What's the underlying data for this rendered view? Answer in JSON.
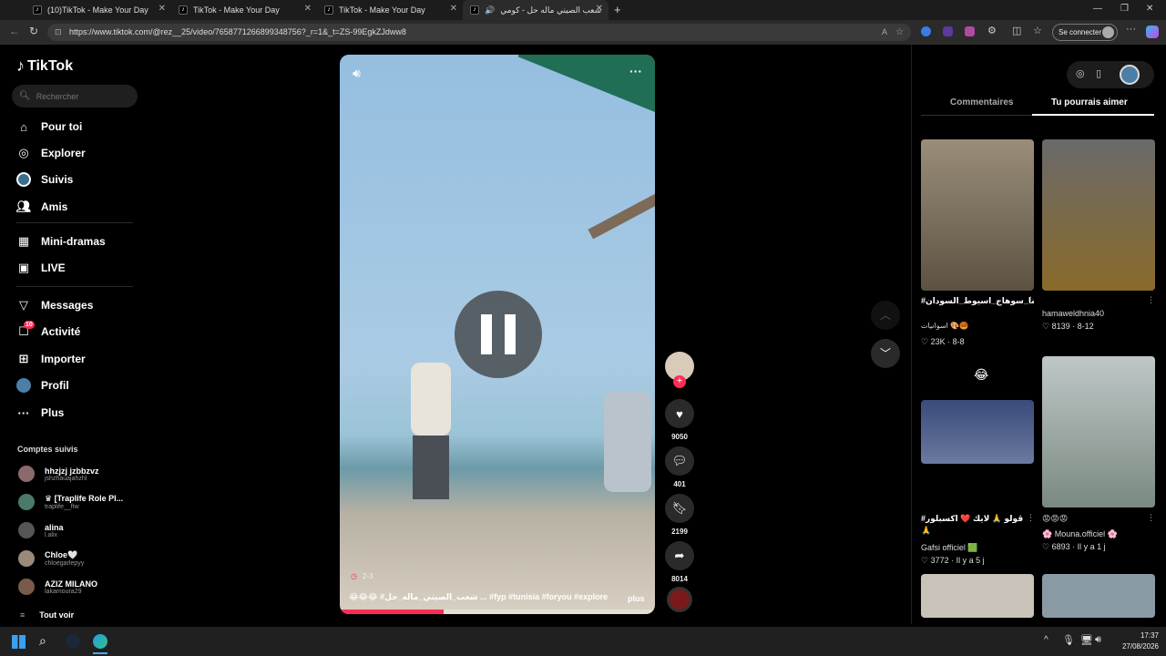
{
  "browser": {
    "tabs": [
      {
        "label": "(10)TikTok - Make Your Day"
      },
      {
        "label": "TikTok - Make Your Day"
      },
      {
        "label": "TikTok - Make Your Day"
      },
      {
        "label": "شعب الصيني ماله حل - كومي"
      }
    ],
    "url": "https://www.tiktok.com/@rez__25/video/7658771266899348756?_r=1&_t=ZS-99EgkZJdww8",
    "signin_label": "Se connecter"
  },
  "sidebar": {
    "logo": "TikTok",
    "search_placeholder": "Rechercher",
    "nav": [
      {
        "label": "Pour toi",
        "icon": "home-icon"
      },
      {
        "label": "Explorer",
        "icon": "compass-icon"
      },
      {
        "label": "Suivis",
        "icon": "following-icon"
      },
      {
        "label": "Amis",
        "icon": "friends-icon"
      },
      {
        "label": "Mini-dramas",
        "icon": "film-icon"
      },
      {
        "label": "LIVE",
        "icon": "live-icon"
      },
      {
        "label": "Messages",
        "icon": "send-icon"
      },
      {
        "label": "Activité",
        "icon": "inbox-icon",
        "badge": "10"
      },
      {
        "label": "Importer",
        "icon": "upload-icon"
      },
      {
        "label": "Profil",
        "icon": "profile-icon"
      },
      {
        "label": "Plus",
        "icon": "more-icon"
      }
    ],
    "following_title": "Comptes suivis",
    "accounts": [
      {
        "name": "hhzjzj jzbbzvz",
        "handle": "jshzhauajahzhl"
      },
      {
        "name": "♛ [Traplife Role Pl...",
        "handle": "traplife__ftw"
      },
      {
        "name": "alina",
        "handle": "l.alix"
      },
      {
        "name": "Chloe🤍",
        "handle": "chloegarlepyy"
      },
      {
        "name": "AZIZ MILANO",
        "handle": "lakamoura29"
      }
    ],
    "see_all": "Tout voir"
  },
  "video": {
    "caption": "😂😂😂 #شعب_الصيني_ماله_حل ... #fyp #tunisia #foryou #explore",
    "more_label": "plus",
    "timestamp": "2-3",
    "progress": 0.33
  },
  "actions": {
    "likes": "9050",
    "comments": "401",
    "saves": "2199",
    "shares": "8014"
  },
  "right_panel": {
    "tabs": [
      "Commentaires",
      "Tu pourrais aimer"
    ],
    "cards": [
      {
        "title": "#اسوان_الاقصر_قنا_سوهاج_اسيوط_السودان",
        "sub": "اسوانيات 🎨🥮",
        "stats": "♡ 23K · 8-8"
      },
      {
        "title": "hamaweldhnia40",
        "sub": "",
        "stats": "♡ 8139 · 8-12"
      },
      {
        "title": "#ڤولو 🙏 لايك ❤️ اكسبلور 🙏",
        "sub": "Gafsi officiel 🟩",
        "stats": "♡ 3772 · Il y a 5 j"
      },
      {
        "title": "😡😡😡",
        "sub": "🌸 Mouna.officiel 🌸",
        "stats": "♡ 6893 · Il y a 1 j"
      }
    ]
  },
  "taskbar": {
    "time": "17:37",
    "date": "27/08/2026"
  }
}
